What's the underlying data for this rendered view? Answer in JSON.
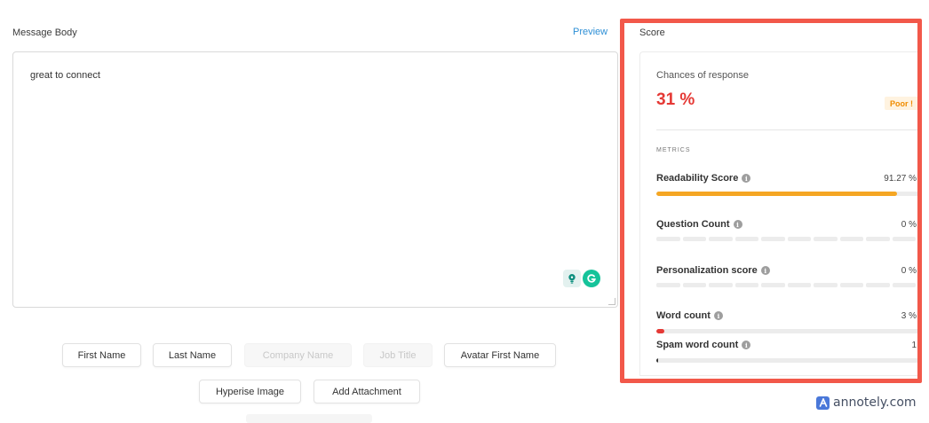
{
  "message": {
    "label": "Message Body",
    "preview_link": "Preview",
    "body_text": "great to connect"
  },
  "variables": {
    "row1": [
      {
        "label": "First Name",
        "enabled": true
      },
      {
        "label": "Last Name",
        "enabled": true
      },
      {
        "label": "Company Name",
        "enabled": false
      },
      {
        "label": "Job Title",
        "enabled": false
      },
      {
        "label": "Avatar First Name",
        "enabled": true
      }
    ],
    "row2": [
      {
        "label": "Hyperise Image",
        "enabled": true
      },
      {
        "label": "Add Attachment",
        "enabled": true
      }
    ]
  },
  "score": {
    "label": "Score",
    "chances_label": "Chances of response",
    "chances_value": "31 %",
    "rating": "Poor !",
    "metrics_heading": "METRICS",
    "metrics": [
      {
        "name": "Readability Score",
        "value": "91.27 %",
        "fraction": 0.9127,
        "bar": "continuous",
        "color": "#f5a623"
      },
      {
        "name": "Question Count",
        "value": "0 %",
        "fraction": 0,
        "bar": "segmented",
        "color": "#ececec"
      },
      {
        "name": "Personalization score",
        "value": "0 %",
        "fraction": 0,
        "bar": "segmented",
        "color": "#ececec"
      },
      {
        "name": "Word count",
        "value": "3 %",
        "fraction": 0.03,
        "bar": "continuous",
        "color": "#e53935"
      },
      {
        "name": "Spam word count",
        "value": "1",
        "fraction": 0.0,
        "bar": "continuous",
        "color": "#333333"
      }
    ]
  },
  "colors": {
    "accent_link": "#2d8fd6",
    "score_red": "#e53935",
    "highlight_frame": "#f2584a",
    "readability_bar": "#f5a623"
  },
  "watermark": {
    "text": "annotely.com"
  }
}
